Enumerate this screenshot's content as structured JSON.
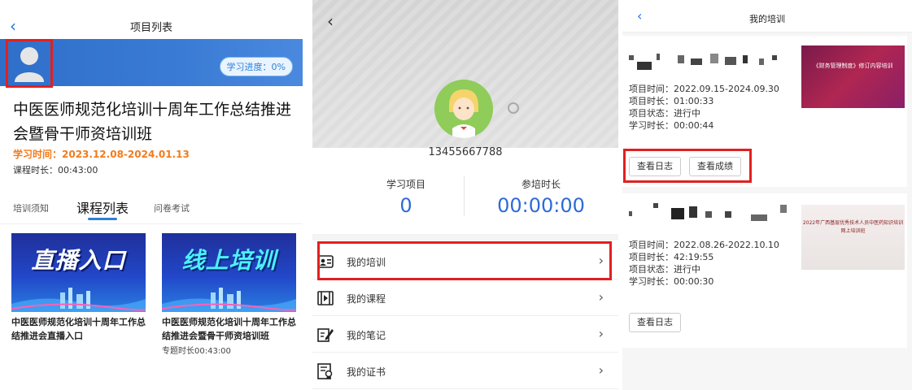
{
  "panel1": {
    "back_glyph": "‹",
    "title": "项目列表",
    "progress": "学习进度：0%",
    "project_title": "中医医师规范化培训十周年工作总结推进会暨骨干师资培训班",
    "study_time": "学习时间：2023.12.08-2024.01.13",
    "course_duration": "课程时长：00:43:00",
    "tabs": [
      "培训须知",
      "课程列表",
      "问卷考试"
    ],
    "cards": [
      {
        "banner": "直播入口",
        "title": "中医医师规范化培训十周年工作总结推进会直播入口",
        "meta": ""
      },
      {
        "banner": "线上培训",
        "title": "中医医师规范化培训十周年工作总结推进会暨骨干师资培训班",
        "meta": "专题时长00:43:00"
      }
    ]
  },
  "panel2": {
    "back_glyph": "‹",
    "phone": "13455667788",
    "stats": [
      {
        "label": "学习项目",
        "value": "0"
      },
      {
        "label": "参培时长",
        "value": "00:00:00"
      }
    ],
    "menu": [
      {
        "label": "我的培训",
        "icon": "training-icon",
        "chevron": "›"
      },
      {
        "label": "我的课程",
        "icon": "course-icon",
        "chevron": "›"
      },
      {
        "label": "我的笔记",
        "icon": "note-icon",
        "chevron": "›"
      },
      {
        "label": "我的证书",
        "icon": "certificate-icon",
        "chevron": "›"
      }
    ]
  },
  "panel3": {
    "back_glyph": "‹",
    "title": "我的培训",
    "trainings": [
      {
        "project_time": "项目时间：2022.09.15-2024.09.30",
        "project_duration": "项目时长：01:00:33",
        "status": "项目状态：进行中",
        "study_duration": "学习时长：00:00:44",
        "thumb_text": "《财务管理制度》修订内容培训",
        "buttons": [
          "查看日志",
          "查看成绩"
        ]
      },
      {
        "project_time": "项目时间：2022.08.26-2022.10.10",
        "project_duration": "项目时长：42:19:55",
        "status": "项目状态：进行中",
        "study_duration": "学习时长：00:00:30",
        "thumb_text": "2022年广西基层优秀技术人员中医药知识培训网上培训班",
        "buttons": [
          "查看日志"
        ]
      }
    ]
  },
  "colors": {
    "accent_blue": "#2e6bd6",
    "highlight_red": "#e02020",
    "orange": "#f27b1b"
  }
}
